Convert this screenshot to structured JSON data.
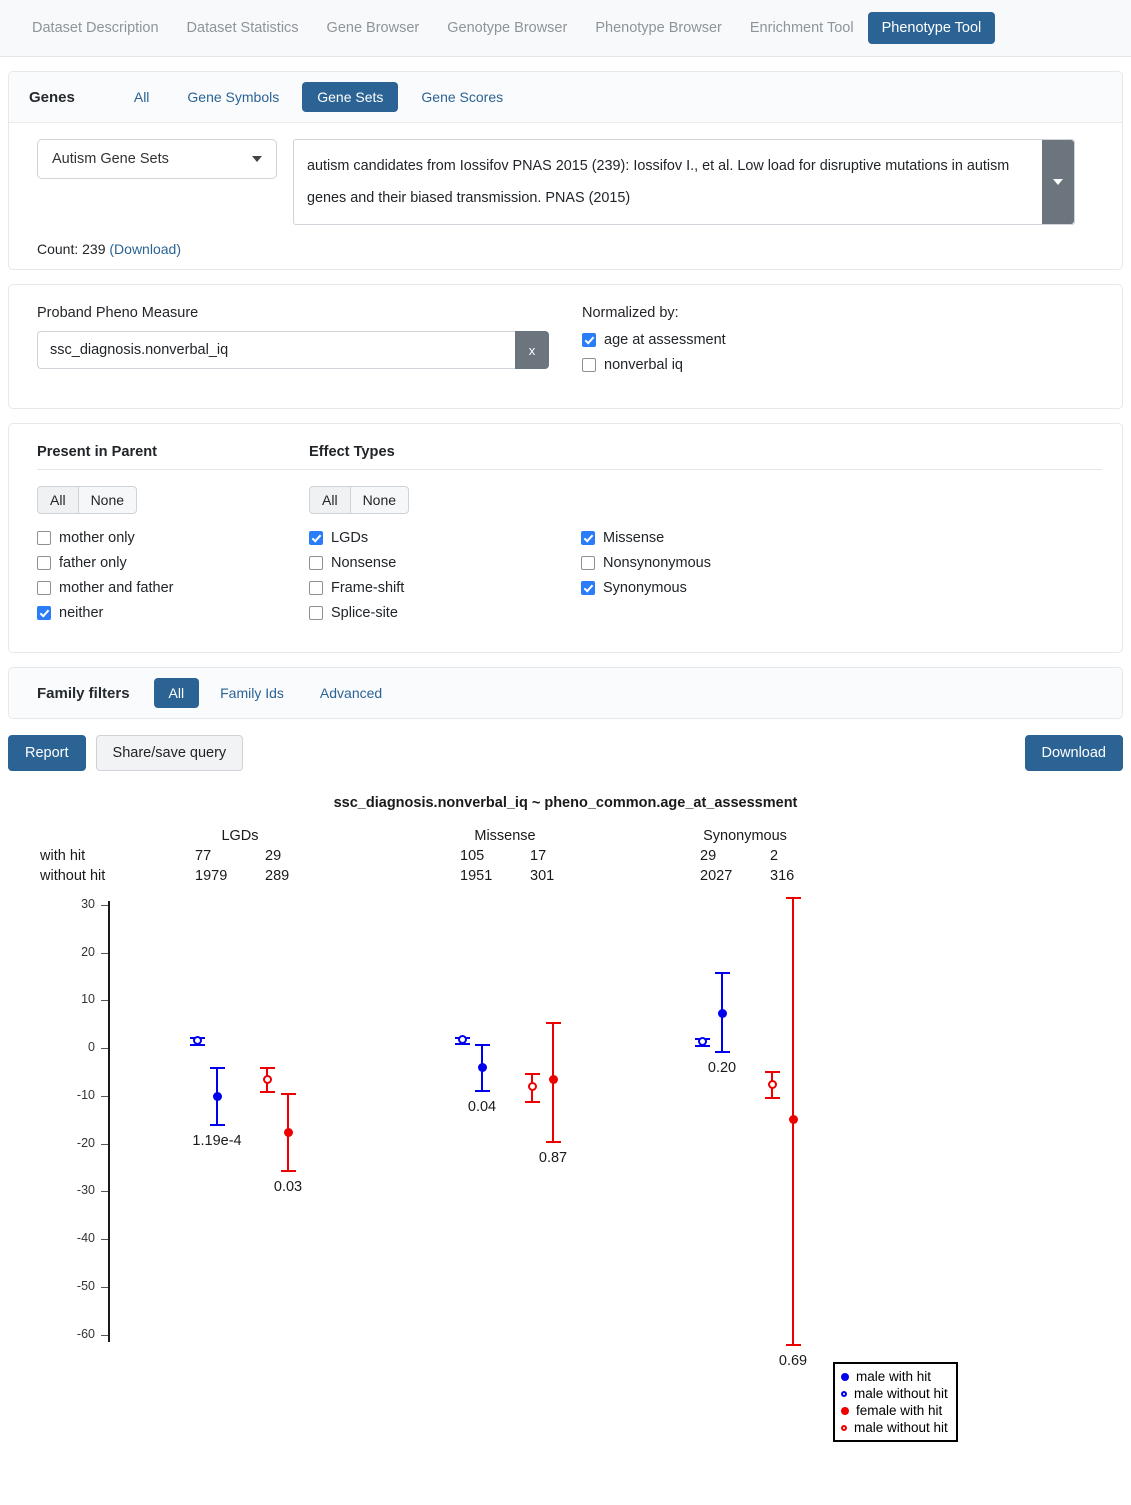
{
  "navbar": {
    "tabs": [
      {
        "label": "Dataset Description",
        "active": false
      },
      {
        "label": "Dataset Statistics",
        "active": false
      },
      {
        "label": "Gene Browser",
        "active": false
      },
      {
        "label": "Genotype Browser",
        "active": false
      },
      {
        "label": "Phenotype Browser",
        "active": false
      },
      {
        "label": "Enrichment Tool",
        "active": false
      },
      {
        "label": "Phenotype Tool",
        "active": true
      }
    ]
  },
  "genes": {
    "title": "Genes",
    "tabs": [
      {
        "label": "All",
        "active": false
      },
      {
        "label": "Gene Symbols",
        "active": false
      },
      {
        "label": "Gene Sets",
        "active": true
      },
      {
        "label": "Gene Scores",
        "active": false
      }
    ],
    "collection_select": "Autism Gene Sets",
    "description": "autism candidates from Iossifov PNAS 2015 (239): Iossifov I., et al. Low load for disruptive mutations in autism genes and their biased transmission. PNAS (2015)",
    "count_label": "Count: 239",
    "download_label": "(Download)"
  },
  "pheno": {
    "measure_label": "Proband Pheno Measure",
    "measure_value": "ssc_diagnosis.nonverbal_iq",
    "clear_label": "x",
    "normalized_title": "Normalized by:",
    "normalized": [
      {
        "label": "age at assessment",
        "checked": true
      },
      {
        "label": "nonverbal iq",
        "checked": false
      }
    ]
  },
  "present_in_parent": {
    "title": "Present in Parent",
    "all_label": "All",
    "none_label": "None",
    "items": [
      {
        "label": "mother only",
        "checked": false
      },
      {
        "label": "father only",
        "checked": false
      },
      {
        "label": "mother and father",
        "checked": false
      },
      {
        "label": "neither",
        "checked": true
      }
    ]
  },
  "effect_types": {
    "title": "Effect Types",
    "all_label": "All",
    "none_label": "None",
    "col1": [
      {
        "label": "LGDs",
        "checked": true
      },
      {
        "label": "Nonsense",
        "checked": false
      },
      {
        "label": "Frame-shift",
        "checked": false
      },
      {
        "label": "Splice-site",
        "checked": false
      }
    ],
    "col2": [
      {
        "label": "Missense",
        "checked": true
      },
      {
        "label": "Nonsynonymous",
        "checked": false
      },
      {
        "label": "Synonymous",
        "checked": true
      }
    ]
  },
  "family_filters": {
    "title": "Family filters",
    "tabs": [
      {
        "label": "All",
        "active": true
      },
      {
        "label": "Family Ids",
        "active": false
      },
      {
        "label": "Advanced",
        "active": false
      }
    ]
  },
  "actions": {
    "report_label": "Report",
    "share_label": "Share/save query",
    "download_label": "Download"
  },
  "chart_data": {
    "type": "scatter",
    "title": "ssc_diagnosis.nonverbal_iq ~ pheno_common.age_at_assessment",
    "xlabel": "",
    "ylabel": "",
    "ylim": [
      -65,
      32
    ],
    "yticks": [
      30,
      20,
      10,
      0,
      -10,
      -20,
      -30,
      -40,
      -50,
      -60
    ],
    "grid": false,
    "legend_position": "bottom-right",
    "row_labels": [
      "with hit",
      "without hit"
    ],
    "groups": [
      {
        "name": "LGDs",
        "counts": {
          "male_with_hit": 77,
          "female_with_hit": 29,
          "male_without_hit": 1979,
          "female_without_hit": 289
        },
        "points": [
          {
            "series": "male without hit",
            "value": 1.5,
            "ci_low": 0.9,
            "ci_high": 2.2,
            "color": "#0000ee",
            "filled": false
          },
          {
            "series": "male with hit",
            "value": -10.2,
            "ci_low": -16.0,
            "ci_high": -4.0,
            "color": "#0000ee",
            "filled": true
          },
          {
            "series": "female without hit",
            "value": -6.6,
            "ci_low": -9.1,
            "ci_high": -4.0,
            "color": "#ee0000",
            "filled": false
          },
          {
            "series": "female with hit",
            "value": -17.6,
            "ci_low": -25.5,
            "ci_high": -9.5,
            "color": "#ee0000",
            "filled": true
          }
        ],
        "pvalues": [
          {
            "series": "male with hit",
            "text": "1.19e-4"
          },
          {
            "series": "female with hit",
            "text": "0.03"
          }
        ]
      },
      {
        "name": "Missense",
        "counts": {
          "male_with_hit": 105,
          "female_with_hit": 17,
          "male_without_hit": 1951,
          "female_without_hit": 301
        },
        "points": [
          {
            "series": "male without hit",
            "value": 1.7,
            "ci_low": 1.0,
            "ci_high": 2.4,
            "color": "#0000ee",
            "filled": false
          },
          {
            "series": "male with hit",
            "value": -4.0,
            "ci_low": -8.8,
            "ci_high": 0.8,
            "color": "#0000ee",
            "filled": true
          },
          {
            "series": "female without hit",
            "value": -8.1,
            "ci_low": -11.0,
            "ci_high": -5.3,
            "color": "#ee0000",
            "filled": false
          },
          {
            "series": "female with hit",
            "value": -6.6,
            "ci_low": -19.5,
            "ci_high": 5.5,
            "color": "#ee0000",
            "filled": true
          }
        ],
        "pvalues": [
          {
            "series": "male with hit",
            "text": "0.04"
          },
          {
            "series": "female with hit",
            "text": "0.87"
          }
        ]
      },
      {
        "name": "Synonymous",
        "counts": {
          "male_with_hit": 29,
          "female_with_hit": 2,
          "male_without_hit": 2027,
          "female_without_hit": 316
        },
        "points": [
          {
            "series": "male without hit",
            "value": 1.3,
            "ci_low": 0.6,
            "ci_high": 2.0,
            "color": "#0000ee",
            "filled": false
          },
          {
            "series": "male with hit",
            "value": 7.3,
            "ci_low": -0.6,
            "ci_high": 15.9,
            "color": "#0000ee",
            "filled": true
          },
          {
            "series": "female without hit",
            "value": -7.6,
            "ci_low": -10.3,
            "ci_high": -4.9,
            "color": "#ee0000",
            "filled": false
          },
          {
            "series": "female with hit",
            "value": -15.0,
            "ci_low": -62.0,
            "ci_high": 31.7,
            "color": "#ee0000",
            "filled": true
          }
        ],
        "pvalues": [
          {
            "series": "male with hit",
            "text": "0.20"
          },
          {
            "series": "female with hit",
            "text": "0.69"
          }
        ]
      }
    ],
    "legend": [
      {
        "label": "male with hit",
        "color": "#0000ee",
        "filled": true
      },
      {
        "label": "male without hit",
        "color": "#0000ee",
        "filled": false
      },
      {
        "label": "female with hit",
        "color": "#ee0000",
        "filled": true
      },
      {
        "label": "male without hit",
        "color": "#ee0000",
        "filled": false
      }
    ]
  }
}
